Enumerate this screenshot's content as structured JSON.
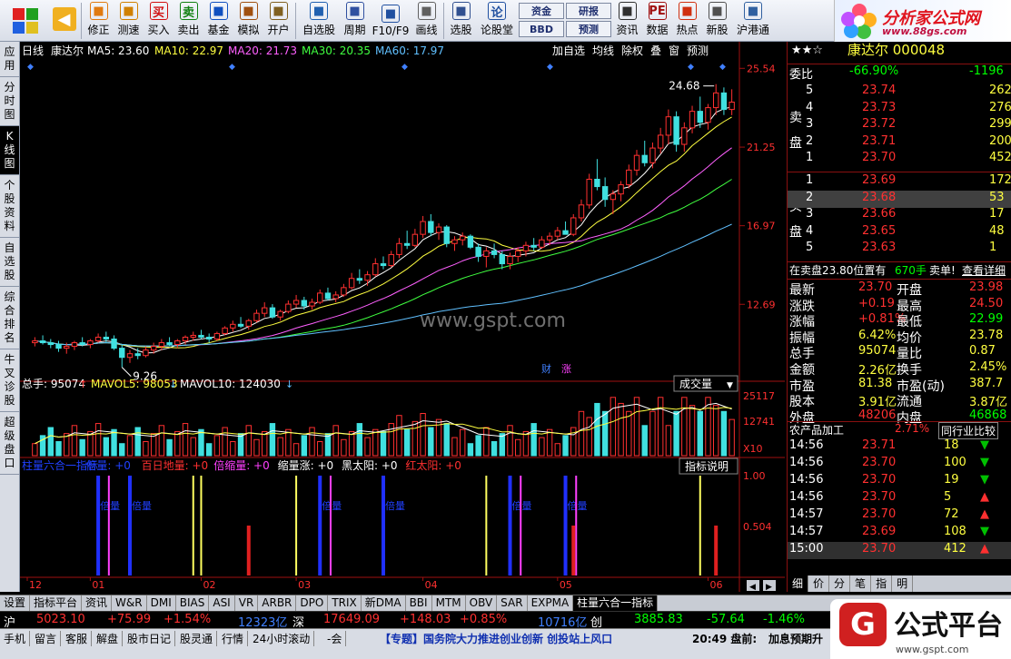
{
  "toolbar": {
    "buttons": [
      {
        "label": "修正",
        "icon": "arrow-up-icon",
        "color": "#e07a10"
      },
      {
        "label": "测速",
        "icon": "clock-icon",
        "color": "#d08000"
      },
      {
        "label": "买入",
        "icon": "buy-icon",
        "color": "#d01010",
        "glyph": "买"
      },
      {
        "label": "卖出",
        "icon": "sell-icon",
        "color": "#108010",
        "glyph": "卖"
      },
      {
        "label": "基金",
        "icon": "fund-icon",
        "color": "#1050c0"
      },
      {
        "label": "模拟",
        "icon": "hammer-icon",
        "color": "#a05010"
      },
      {
        "label": "开户",
        "icon": "lock-icon",
        "color": "#806020"
      },
      {
        "label": "自选股",
        "icon": "star-list-icon",
        "color": "#2060b0"
      },
      {
        "label": "周期",
        "icon": "period-icon",
        "color": "#3050a0"
      },
      {
        "label": "F10/F9",
        "icon": "f10-icon",
        "color": "#2050a0"
      },
      {
        "label": "画线",
        "icon": "pen-icon",
        "color": "#606060"
      },
      {
        "label": "选股",
        "icon": "select-icon",
        "color": "#305090"
      },
      {
        "label": "论股堂",
        "icon": "forum-icon",
        "color": "#2050a0",
        "glyph": "论"
      },
      {
        "label": "资讯",
        "icon": "news-icon",
        "color": "#303030"
      },
      {
        "label": "数据",
        "icon": "pe-icon",
        "color": "#a01010",
        "glyph": "PE"
      },
      {
        "label": "热点",
        "icon": "hot-icon",
        "color": "#d03010"
      },
      {
        "label": "新股",
        "icon": "newstock-icon",
        "color": "#505050"
      },
      {
        "label": "沪港通",
        "icon": "hk-icon",
        "color": "#3060a0"
      }
    ],
    "small_buttons": [
      "资金",
      "BBD",
      "研报",
      "预测"
    ]
  },
  "brand": {
    "name": "分析家公式网",
    "url": "www.88gs.com"
  },
  "side_tabs": [
    "应用",
    "分时图",
    "K线图",
    "个股资料",
    "自选股",
    "综合排名",
    "牛叉诊股",
    "超级盘口"
  ],
  "kline": {
    "period": "日线",
    "stock": "康达尔",
    "ma": [
      {
        "label": "MA5: 23.60",
        "color": "#ffffff"
      },
      {
        "label": "MA10: 22.97",
        "color": "#ffff40"
      },
      {
        "label": "MA20: 21.73",
        "color": "#ff60ff"
      },
      {
        "label": "MA30: 20.35",
        "color": "#40ff40"
      },
      {
        "label": "MA60: 17.97",
        "color": "#60c0ff"
      }
    ],
    "top_buttons": [
      "加自选",
      "均线",
      "除权",
      "叠",
      "窗",
      "预测"
    ],
    "y_labels": [
      "25.54",
      "21.25",
      "16.97",
      "12.69"
    ],
    "high_label": "24.68",
    "low_label": "9.26",
    "watermark": "www.gspt.com",
    "tags": [
      "财",
      "涨"
    ]
  },
  "volume": {
    "title": "总手: 95074",
    "mavol5": "MAVOL5: 98053",
    "mavol10": "MAVOL10: 124030",
    "dropdown": "成交量",
    "y_labels": [
      "25117",
      "12741",
      "X10"
    ]
  },
  "indicator": {
    "items": [
      {
        "label": "柱量六合一指标",
        "color": "#2040ff"
      },
      {
        "label": "倍量: +0",
        "color": "#2040ff"
      },
      {
        "label": "百日地量: +0",
        "color": "#ff3030"
      },
      {
        "label": "倍缩量: +0",
        "color": "#ff40ff"
      },
      {
        "label": "缩量涨: +0",
        "color": "#ffffff"
      },
      {
        "label": "黑太阳: +0",
        "color": "#ffffff"
      },
      {
        "label": "红太阳: +0",
        "color": "#ff3030"
      }
    ],
    "explain": "指标说明",
    "bar_label": "倍量",
    "y_labels": [
      "1.00",
      "0.504"
    ]
  },
  "x_labels": [
    "12",
    "01",
    "02",
    "03",
    "04",
    "05",
    "06"
  ],
  "quote": {
    "header": "康达尔 000048",
    "weibi_label": "委比",
    "weibi_value": "-66.90%",
    "weibi_diff": "-1196",
    "sell_label": "卖盘",
    "buy_label": "买盘",
    "sells": [
      {
        "lv": "5",
        "price": "23.74",
        "vol": "262"
      },
      {
        "lv": "4",
        "price": "23.73",
        "vol": "276"
      },
      {
        "lv": "3",
        "price": "23.72",
        "vol": "299"
      },
      {
        "lv": "2",
        "price": "23.71",
        "vol": "200"
      },
      {
        "lv": "1",
        "price": "23.70",
        "vol": "452"
      }
    ],
    "buys": [
      {
        "lv": "1",
        "price": "23.69",
        "vol": "172"
      },
      {
        "lv": "2",
        "price": "23.68",
        "vol": "53"
      },
      {
        "lv": "3",
        "price": "23.66",
        "vol": "17"
      },
      {
        "lv": "4",
        "price": "23.65",
        "vol": "48"
      },
      {
        "lv": "5",
        "price": "23.63",
        "vol": "1"
      }
    ],
    "ticker": "在卖盘23.80位置有",
    "ticker_vol": "670手",
    "ticker_action": "卖单!",
    "ticker_more": "查看详细",
    "stats": [
      [
        "最新",
        "23.70",
        "开盘",
        "23.98"
      ],
      [
        "涨跌",
        "+0.19",
        "最高",
        "24.50"
      ],
      [
        "涨幅",
        "+0.81%",
        "最低",
        "22.99"
      ],
      [
        "振幅",
        "6.42%",
        "均价",
        "23.78"
      ],
      [
        "总手",
        "95074",
        "量比",
        "0.87"
      ],
      [
        "金额",
        "2.26亿",
        "换手",
        "2.45%"
      ],
      [
        "市盈",
        "81.38",
        "市盈(动)",
        "387.7"
      ],
      [
        "股本",
        "3.91亿",
        "流通",
        "3.87亿"
      ],
      [
        "外盘",
        "48206",
        "内盘",
        "46868"
      ]
    ],
    "industry": "农产品加工",
    "industry_pct": "2.71%",
    "industry_cmp": "同行业比较",
    "trades": [
      {
        "time": "14:56",
        "price": "23.71",
        "vol": "18",
        "dir": "down"
      },
      {
        "time": "14:56",
        "price": "23.70",
        "vol": "100",
        "dir": "down"
      },
      {
        "time": "14:56",
        "price": "23.70",
        "vol": "19",
        "dir": "down"
      },
      {
        "time": "14:56",
        "price": "23.70",
        "vol": "5",
        "dir": "up"
      },
      {
        "time": "14:57",
        "price": "23.70",
        "vol": "72",
        "dir": "up"
      },
      {
        "time": "14:57",
        "price": "23.69",
        "vol": "108",
        "dir": "down"
      },
      {
        "time": "15:00",
        "price": "23.70",
        "vol": "412",
        "dir": "up"
      }
    ],
    "bottom_tabs": [
      "细",
      "价",
      "分",
      "笔",
      "指",
      "明"
    ]
  },
  "bottom_tabs": [
    "设置",
    "指标平台",
    "资讯",
    "W&R",
    "DMI",
    "BIAS",
    "ASI",
    "VR",
    "ARBR",
    "DPO",
    "TRIX",
    "新DMA",
    "BBI",
    "MTM",
    "OBV",
    "SAR",
    "EXPMA",
    "柱量六合一指标"
  ],
  "index_bar": {
    "sh": "沪",
    "sh_val": "5023.10",
    "sh_chg": "+75.99",
    "sh_pct": "+1.54%",
    "sh_amt": "12323亿",
    "sz": "深",
    "sz_val": "17649.09",
    "sz_chg": "+148.03",
    "sz_pct": "+0.85%",
    "sz_amt": "10716亿",
    "cy": "创",
    "cy_val": "3885.83",
    "cy_chg": "-57.64",
    "cy_pct": "-1.46%"
  },
  "status": {
    "items": [
      "手机",
      "留言",
      "客服",
      "解盘",
      "股市日记",
      "股灵通",
      "行情",
      "24小时滚动",
      "-会"
    ],
    "news": "【专题】国务院大力推进创业创新 创投站上风口",
    "time": "20:49 盘前:",
    "news2": "加息预期升"
  },
  "gspt": {
    "name": "公式平台",
    "url": "www.gspt.com"
  },
  "chart_data": {
    "type": "candlestick",
    "note_source": "price-chart",
    "candles": [
      [
        10.6,
        10.9,
        10.4,
        10.7
      ],
      [
        10.7,
        11.0,
        10.5,
        10.6
      ],
      [
        10.6,
        10.8,
        10.3,
        10.5
      ],
      [
        10.5,
        10.7,
        10.1,
        10.3
      ],
      [
        10.3,
        10.6,
        10.0,
        10.4
      ],
      [
        10.4,
        10.7,
        10.2,
        10.6
      ],
      [
        10.6,
        10.9,
        10.4,
        10.5
      ],
      [
        10.5,
        10.8,
        10.3,
        10.7
      ],
      [
        10.7,
        11.1,
        10.6,
        10.9
      ],
      [
        10.9,
        11.2,
        10.6,
        10.8
      ],
      [
        10.8,
        11.0,
        10.2,
        10.3
      ],
      [
        10.3,
        10.5,
        9.26,
        9.8
      ],
      [
        9.8,
        10.2,
        9.5,
        10.0
      ],
      [
        10.0,
        10.3,
        9.7,
        9.9
      ],
      [
        9.9,
        10.4,
        9.8,
        10.2
      ],
      [
        10.2,
        10.6,
        10.0,
        10.4
      ],
      [
        10.4,
        10.8,
        10.2,
        10.6
      ],
      [
        10.6,
        10.9,
        10.4,
        10.5
      ],
      [
        10.5,
        10.8,
        10.3,
        10.7
      ],
      [
        10.7,
        11.0,
        10.5,
        10.9
      ],
      [
        10.9,
        11.2,
        10.7,
        11.0
      ],
      [
        11.0,
        11.3,
        10.8,
        10.9
      ],
      [
        10.9,
        11.1,
        10.6,
        10.8
      ],
      [
        10.8,
        11.2,
        10.7,
        11.1
      ],
      [
        11.1,
        11.5,
        11.0,
        11.4
      ],
      [
        11.4,
        11.8,
        11.2,
        11.6
      ],
      [
        11.6,
        12.0,
        11.4,
        11.5
      ],
      [
        11.5,
        11.9,
        11.3,
        11.8
      ],
      [
        11.8,
        12.4,
        11.7,
        12.2
      ],
      [
        12.2,
        12.8,
        12.0,
        12.5
      ],
      [
        12.5,
        12.7,
        11.9,
        12.0
      ],
      [
        12.0,
        12.4,
        11.8,
        12.3
      ],
      [
        12.3,
        12.9,
        12.2,
        12.7
      ],
      [
        12.7,
        13.2,
        12.5,
        12.9
      ],
      [
        12.9,
        13.1,
        12.4,
        12.6
      ],
      [
        12.6,
        13.0,
        12.4,
        12.8
      ],
      [
        12.8,
        13.5,
        12.7,
        13.3
      ],
      [
        13.3,
        13.6,
        12.9,
        13.0
      ],
      [
        13.0,
        13.4,
        12.8,
        13.2
      ],
      [
        13.2,
        13.8,
        13.1,
        13.6
      ],
      [
        13.6,
        14.4,
        13.5,
        14.1
      ],
      [
        14.1,
        14.6,
        13.8,
        14.0
      ],
      [
        14.0,
        14.5,
        13.7,
        14.3
      ],
      [
        14.3,
        15.2,
        14.2,
        14.9
      ],
      [
        14.9,
        15.3,
        14.6,
        14.8
      ],
      [
        14.8,
        15.6,
        14.7,
        15.4
      ],
      [
        15.4,
        16.3,
        15.2,
        16.0
      ],
      [
        16.0,
        16.7,
        15.7,
        15.9
      ],
      [
        15.9,
        16.8,
        15.8,
        16.5
      ],
      [
        16.5,
        17.5,
        16.3,
        17.2
      ],
      [
        17.2,
        17.6,
        16.4,
        16.6
      ],
      [
        16.6,
        17.1,
        16.2,
        16.9
      ],
      [
        16.9,
        17.0,
        15.8,
        16.0
      ],
      [
        16.0,
        16.4,
        15.6,
        16.2
      ],
      [
        16.2,
        16.6,
        15.9,
        16.4
      ],
      [
        16.4,
        16.5,
        15.7,
        15.8
      ],
      [
        15.8,
        16.0,
        15.0,
        15.3
      ],
      [
        15.3,
        15.8,
        14.7,
        15.6
      ],
      [
        15.6,
        16.0,
        15.2,
        15.4
      ],
      [
        15.4,
        15.6,
        14.6,
        14.9
      ],
      [
        14.9,
        15.5,
        14.6,
        15.3
      ],
      [
        15.3,
        15.8,
        15.0,
        15.6
      ],
      [
        15.6,
        16.1,
        15.3,
        15.9
      ],
      [
        15.9,
        16.3,
        15.6,
        15.8
      ],
      [
        15.8,
        16.4,
        15.7,
        16.2
      ],
      [
        16.2,
        16.6,
        15.9,
        16.4
      ],
      [
        16.4,
        16.9,
        16.2,
        16.7
      ],
      [
        16.7,
        17.2,
        16.5,
        16.5
      ],
      [
        16.5,
        17.6,
        16.4,
        17.4
      ],
      [
        17.4,
        18.4,
        17.2,
        18.1
      ],
      [
        18.1,
        19.8,
        17.9,
        19.5
      ],
      [
        19.5,
        20.6,
        18.9,
        19.1
      ],
      [
        19.1,
        19.6,
        18.0,
        18.4
      ],
      [
        18.4,
        18.9,
        17.6,
        18.7
      ],
      [
        18.7,
        19.4,
        18.3,
        19.2
      ],
      [
        19.2,
        20.3,
        19.0,
        20.0
      ],
      [
        20.0,
        21.1,
        19.7,
        20.8
      ],
      [
        20.8,
        21.6,
        20.2,
        20.4
      ],
      [
        20.4,
        21.5,
        20.1,
        21.2
      ],
      [
        21.2,
        22.3,
        20.9,
        21.9
      ],
      [
        21.9,
        23.3,
        21.4,
        22.9
      ],
      [
        22.9,
        23.2,
        21.0,
        21.4
      ],
      [
        21.4,
        22.6,
        21.0,
        22.3
      ],
      [
        22.3,
        23.5,
        22.0,
        23.2
      ],
      [
        23.2,
        24.0,
        22.3,
        22.6
      ],
      [
        22.6,
        23.6,
        22.2,
        23.4
      ],
      [
        23.4,
        24.68,
        23.0,
        24.2
      ],
      [
        24.2,
        24.5,
        23.0,
        23.3
      ],
      [
        23.3,
        24.4,
        22.99,
        23.7
      ]
    ]
  }
}
